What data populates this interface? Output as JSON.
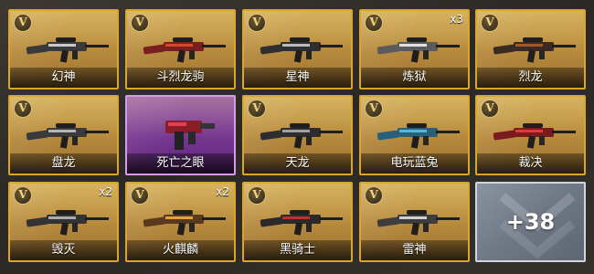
{
  "items": [
    {
      "name": "幻神",
      "badge": "V",
      "qty": "",
      "rarity": "gold"
    },
    {
      "name": "斗烈龙驹",
      "badge": "V",
      "qty": "",
      "rarity": "gold"
    },
    {
      "name": "星神",
      "badge": "V",
      "qty": "",
      "rarity": "gold"
    },
    {
      "name": "炼狱",
      "badge": "V",
      "qty": "x3",
      "rarity": "gold"
    },
    {
      "name": "烈龙",
      "badge": "V",
      "qty": "",
      "rarity": "gold"
    },
    {
      "name": "盘龙",
      "badge": "V",
      "qty": "",
      "rarity": "gold"
    },
    {
      "name": "死亡之眼",
      "badge": "",
      "qty": "",
      "rarity": "purple"
    },
    {
      "name": "天龙",
      "badge": "V",
      "qty": "",
      "rarity": "gold"
    },
    {
      "name": "电玩蓝兔",
      "badge": "V",
      "qty": "",
      "rarity": "gold"
    },
    {
      "name": "裁决",
      "badge": "V",
      "qty": "",
      "rarity": "gold"
    },
    {
      "name": "毁灭",
      "badge": "V",
      "qty": "x2",
      "rarity": "gold"
    },
    {
      "name": "火麒麟",
      "badge": "V",
      "qty": "x2",
      "rarity": "gold"
    },
    {
      "name": "黑骑士",
      "badge": "V",
      "qty": "",
      "rarity": "gold"
    },
    {
      "name": "雷神",
      "badge": "V",
      "qty": "",
      "rarity": "gold"
    }
  ],
  "more": {
    "count": "+38"
  },
  "colors": {
    "gold_border": "#d9a62a",
    "purple_border": "#d59be6",
    "more_bg": "#6f7885"
  },
  "icons": {
    "tier_badge": "v-badge-icon",
    "weapon": "weapon-icon",
    "more": "chevron-icon"
  }
}
